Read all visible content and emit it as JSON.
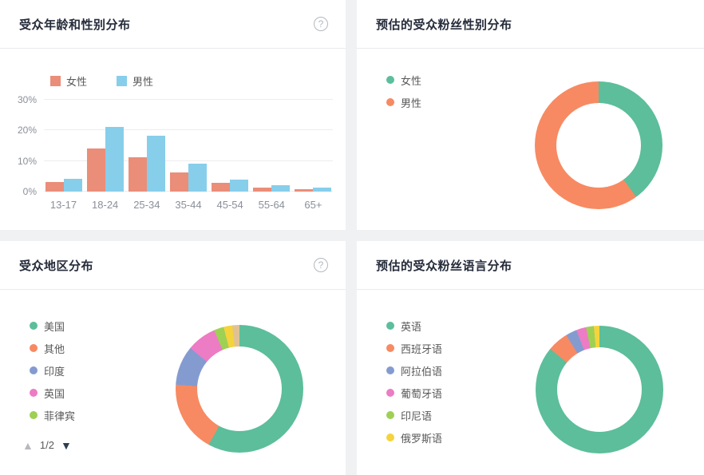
{
  "ui": {
    "help_icon": "?"
  },
  "chart_data": [
    {
      "type": "bar",
      "title": "受众年龄和性别分布",
      "has_help_icon": true,
      "categories": [
        "13-17",
        "18-24",
        "25-34",
        "35-44",
        "45-54",
        "55-64",
        "65+"
      ],
      "series": [
        {
          "name": "女性",
          "color": "#ea8e79",
          "values": [
            3.2,
            14.2,
            11.2,
            6.2,
            2.9,
            1.3,
            0.9
          ]
        },
        {
          "name": "男性",
          "color": "#87ceeb",
          "values": [
            4.1,
            21.1,
            18.3,
            9.1,
            3.8,
            2.0,
            1.3
          ]
        }
      ],
      "ylabel": "",
      "xlabel": "",
      "ylim": [
        0,
        30
      ],
      "yticks": [
        "0%",
        "10%",
        "20%",
        "30%"
      ],
      "grid": true,
      "legend_position": "top-left"
    },
    {
      "type": "pie",
      "donut": true,
      "title": "预估的受众粉丝性别分布",
      "has_help_icon": false,
      "legend_position": "left",
      "segments": [
        {
          "label": "女性",
          "value": 40,
          "color": "#5cbe9b"
        },
        {
          "label": "男性",
          "value": 60,
          "color": "#f78a62"
        }
      ]
    },
    {
      "type": "pie",
      "donut": true,
      "title": "受众地区分布",
      "has_help_icon": true,
      "legend_position": "left",
      "legend_visible_count": 5,
      "legend_pagination": {
        "up": "▲",
        "current": "1/2",
        "down": "▼"
      },
      "segments": [
        {
          "label": "美国",
          "value": 58,
          "color": "#5cbe9b"
        },
        {
          "label": "其他",
          "value": 18,
          "color": "#f78a62"
        },
        {
          "label": "印度",
          "value": 10,
          "color": "#849bd0"
        },
        {
          "label": "英国",
          "value": 7.5,
          "color": "#ec7cc4"
        },
        {
          "label": "菲律宾",
          "value": 2.5,
          "color": "#9ed054"
        },
        {
          "label": "",
          "value": 2.2,
          "color": "#f5d33d"
        },
        {
          "label": "",
          "value": 1.8,
          "color": "#dfc294"
        }
      ]
    },
    {
      "type": "pie",
      "donut": true,
      "title": "预估的受众粉丝语言分布",
      "has_help_icon": false,
      "legend_position": "left",
      "segments": [
        {
          "label": "英语",
          "value": 86,
          "color": "#5cbe9b"
        },
        {
          "label": "西班牙语",
          "value": 5.3,
          "color": "#f78a62"
        },
        {
          "label": "阿拉伯语",
          "value": 2.8,
          "color": "#849bd0"
        },
        {
          "label": "葡萄牙语",
          "value": 2.5,
          "color": "#ec7cc4"
        },
        {
          "label": "印尼语",
          "value": 2.0,
          "color": "#9ed054"
        },
        {
          "label": "俄罗斯语",
          "value": 1.4,
          "color": "#f5d33d"
        }
      ]
    }
  ]
}
